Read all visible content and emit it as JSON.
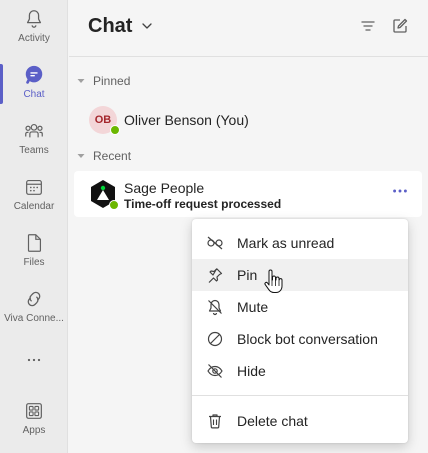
{
  "rail": {
    "items": [
      {
        "label": "Activity",
        "icon": "bell-icon"
      },
      {
        "label": "Chat",
        "icon": "chat-icon",
        "active": true
      },
      {
        "label": "Teams",
        "icon": "teams-icon"
      },
      {
        "label": "Calendar",
        "icon": "calendar-icon"
      },
      {
        "label": "Files",
        "icon": "file-icon"
      },
      {
        "label": "Viva Conne...",
        "icon": "viva-connections-icon"
      },
      {
        "label": "Apps",
        "icon": "apps-icon"
      }
    ],
    "more": "more-apps-icon"
  },
  "pane": {
    "title": "Chat",
    "pinned_label": "Pinned",
    "recent_label": "Recent",
    "pinned": [
      {
        "initials": "OB",
        "name": "Oliver Benson (You)",
        "presence": "available"
      }
    ],
    "recent": [
      {
        "name": "Sage People",
        "preview": "Time-off request processed",
        "presence": "available"
      }
    ]
  },
  "menu": {
    "items": [
      {
        "label": "Mark as unread",
        "icon": "mark-unread-icon"
      },
      {
        "label": "Pin",
        "icon": "pin-icon"
      },
      {
        "label": "Mute",
        "icon": "mute-icon"
      },
      {
        "label": "Block bot conversation",
        "icon": "block-icon"
      },
      {
        "label": "Hide",
        "icon": "hide-icon"
      },
      {
        "label": "Delete chat",
        "icon": "trash-icon"
      }
    ]
  },
  "colors": {
    "accent": "#5b5fc7",
    "presence_available": "#6bb700",
    "avatar_bg": "#f3d6d8",
    "avatar_fg": "#a4262c"
  }
}
